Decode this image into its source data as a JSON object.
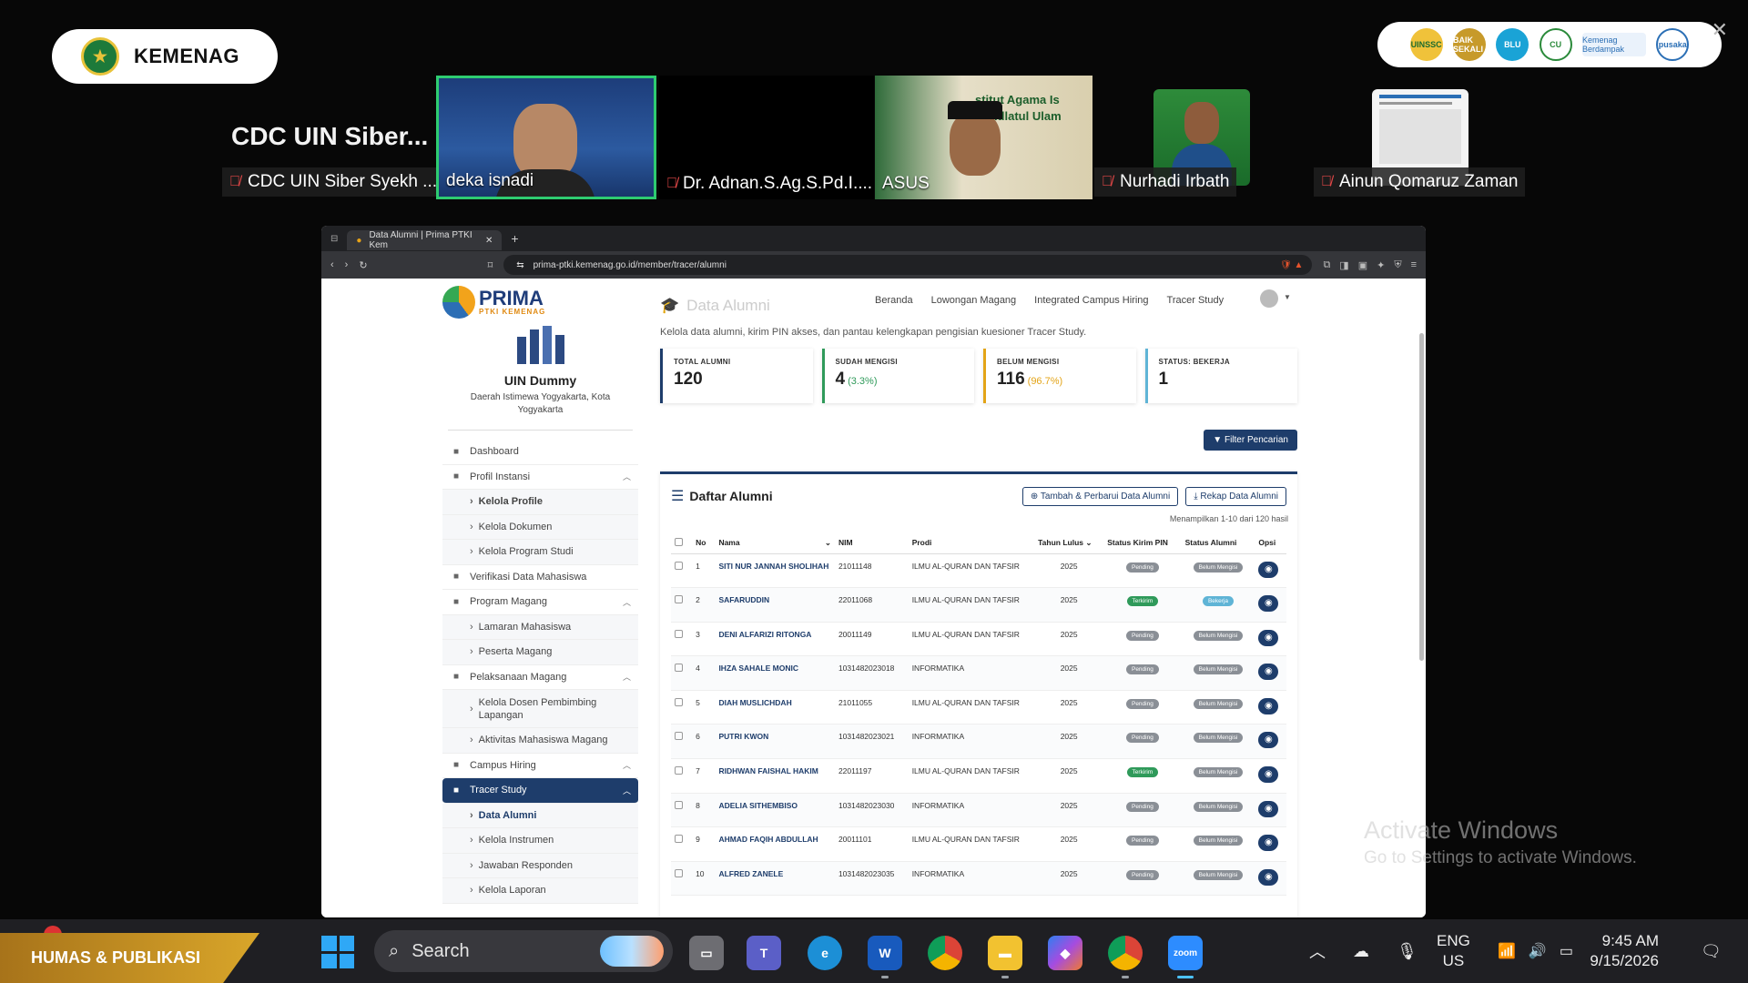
{
  "overlay": {
    "brand": "KEMENAG",
    "sponsors": [
      "UINSSC",
      "BAIK SEKALI",
      "BLU",
      "CU",
      "Kemenag Berdampak",
      "pusaka"
    ],
    "activate_windows": {
      "line1": "Activate Windows",
      "line2": "Go to Settings to activate Windows."
    },
    "humas_banner": "HUMAS & PUBLIKASI"
  },
  "meeting": {
    "host_title": "CDC UIN Siber...",
    "participants": [
      {
        "name": "CDC UIN Siber Syekh ...",
        "muted": true
      },
      {
        "name": "deka isnadi",
        "muted": false,
        "speaking": true
      },
      {
        "name": "Dr. Adnan.S.Ag.S.Pd.I....",
        "muted": true
      },
      {
        "name": "ASUS",
        "muted": false
      },
      {
        "name": "Nurhadi Irbath",
        "muted": true
      },
      {
        "name": "Ainun Qomaruz Zaman",
        "muted": true
      }
    ],
    "background_text": "stitut Agama Is Nahdlatul Ulam"
  },
  "browser": {
    "tab_title": "Data Alumni | Prima PTKI Kem",
    "url": "prima-ptki.kemenag.go.id/member/tracer/alumni"
  },
  "site": {
    "logo": "PRIMA",
    "logo_sub": "PTKI KEMENAG",
    "nav": [
      "Beranda",
      "Lowongan Magang",
      "Integrated Campus Hiring",
      "Tracer Study"
    ]
  },
  "sidebar": {
    "institution": "UIN Dummy",
    "location": "Daerah Istimewa Yogyakarta, Kota Yogyakarta",
    "menu": [
      {
        "label": "Dashboard",
        "type": "top",
        "icon": "dashboard-icon"
      },
      {
        "label": "Profil Instansi",
        "type": "parent",
        "icon": "building-icon"
      },
      {
        "label": "Kelola Profile",
        "type": "sub",
        "bold": true
      },
      {
        "label": "Kelola Dokumen",
        "type": "sub"
      },
      {
        "label": "Kelola Program Studi",
        "type": "sub"
      },
      {
        "label": "Verifikasi Data Mahasiswa",
        "type": "top",
        "icon": "users-icon"
      },
      {
        "label": "Program Magang",
        "type": "parent",
        "icon": "briefcase-icon"
      },
      {
        "label": "Lamaran Mahasiswa",
        "type": "sub"
      },
      {
        "label": "Peserta Magang",
        "type": "sub"
      },
      {
        "label": "Pelaksanaan Magang",
        "type": "parent",
        "icon": "calendar-icon"
      },
      {
        "label": "Kelola Dosen Pembimbing Lapangan",
        "type": "sub",
        "tall": true
      },
      {
        "label": "Aktivitas Mahasiswa Magang",
        "type": "sub"
      },
      {
        "label": "Campus Hiring",
        "type": "parent",
        "icon": "person-tie-icon"
      },
      {
        "label": "Tracer Study",
        "type": "parent",
        "active": true,
        "icon": "graduation-icon"
      },
      {
        "label": "Data Alumni",
        "type": "sub",
        "current": true
      },
      {
        "label": "Kelola Instrumen",
        "type": "sub"
      },
      {
        "label": "Jawaban Responden",
        "type": "sub"
      },
      {
        "label": "Kelola Laporan",
        "type": "sub"
      }
    ]
  },
  "main": {
    "title": "Data Alumni",
    "description": "Kelola data alumni, kirim PIN akses, dan pantau kelengkapan pengisian kuesioner Tracer Study.",
    "stats": [
      {
        "label": "TOTAL ALUMNI",
        "value": "120",
        "pct": ""
      },
      {
        "label": "SUDAH MENGISI",
        "value": "4",
        "pct": "(3.3%)"
      },
      {
        "label": "BELUM MENGISI",
        "value": "116",
        "pct": "(96.7%)"
      },
      {
        "label": "STATUS: BEKERJA",
        "value": "1",
        "pct": ""
      }
    ],
    "filter_button": "Filter Pencarian",
    "list_title": "Daftar Alumni",
    "add_button": "Tambah & Perbarui Data Alumni",
    "recap_button": "Rekap Data Alumni",
    "showing": "Menampilkan 1-10 dari 120 hasil",
    "columns": [
      "No",
      "Nama",
      "NIM",
      "Prodi",
      "Tahun Lulus",
      "Status Kirim PIN",
      "Status Alumni",
      "Opsi"
    ],
    "rows": [
      {
        "no": "1",
        "nama": "SITI NUR JANNAH SHOLIHAH",
        "nim": "21011148",
        "prodi": "ILMU AL-QURAN DAN TAFSIR",
        "tahun": "2025",
        "pin": "Pending",
        "alumni": "Belum Mengisi"
      },
      {
        "no": "2",
        "nama": "SAFARUDDIN",
        "nim": "22011068",
        "prodi": "ILMU AL-QURAN DAN TAFSIR",
        "tahun": "2025",
        "pin": "Terkirim",
        "alumni": "Bekerja"
      },
      {
        "no": "3",
        "nama": "DENI ALFARIZI RITONGA",
        "nim": "20011149",
        "prodi": "ILMU AL-QURAN DAN TAFSIR",
        "tahun": "2025",
        "pin": "Pending",
        "alumni": "Belum Mengisi"
      },
      {
        "no": "4",
        "nama": "IHZA SAHALE MONIC",
        "nim": "1031482023018",
        "prodi": "INFORMATIKA",
        "tahun": "2025",
        "pin": "Pending",
        "alumni": "Belum Mengisi"
      },
      {
        "no": "5",
        "nama": "DIAH MUSLICHDAH",
        "nim": "21011055",
        "prodi": "ILMU AL-QURAN DAN TAFSIR",
        "tahun": "2025",
        "pin": "Pending",
        "alumni": "Belum Mengisi"
      },
      {
        "no": "6",
        "nama": "PUTRI KWON",
        "nim": "1031482023021",
        "prodi": "INFORMATIKA",
        "tahun": "2025",
        "pin": "Pending",
        "alumni": "Belum Mengisi"
      },
      {
        "no": "7",
        "nama": "RIDHWAN FAISHAL HAKIM",
        "nim": "22011197",
        "prodi": "ILMU AL-QURAN DAN TAFSIR",
        "tahun": "2025",
        "pin": "Terkirim",
        "alumni": "Belum Mengisi"
      },
      {
        "no": "8",
        "nama": "ADELIA SITHEMBISO",
        "nim": "1031482023030",
        "prodi": "INFORMATIKA",
        "tahun": "2025",
        "pin": "Pending",
        "alumni": "Belum Mengisi"
      },
      {
        "no": "9",
        "nama": "AHMAD FAQIH ABDULLAH",
        "nim": "20011101",
        "prodi": "ILMU AL-QURAN DAN TAFSIR",
        "tahun": "2025",
        "pin": "Pending",
        "alumni": "Belum Mengisi"
      },
      {
        "no": "10",
        "nama": "ALFRED ZANELE",
        "nim": "1031482023035",
        "prodi": "INFORMATIKA",
        "tahun": "2025",
        "pin": "Pending",
        "alumni": "Belum Mengisi"
      }
    ]
  },
  "taskbar": {
    "search_placeholder": "Search",
    "lang_line1": "ENG",
    "lang_line2": "US",
    "time": "9:45 AM",
    "date": "9/15/2026"
  },
  "colors": {
    "primary": "#1e3d6b",
    "success": "#2f9a5a",
    "warning": "#e3a417",
    "info": "#5fb4d6",
    "speaking": "#2ecc71",
    "muted": "#e54848"
  }
}
